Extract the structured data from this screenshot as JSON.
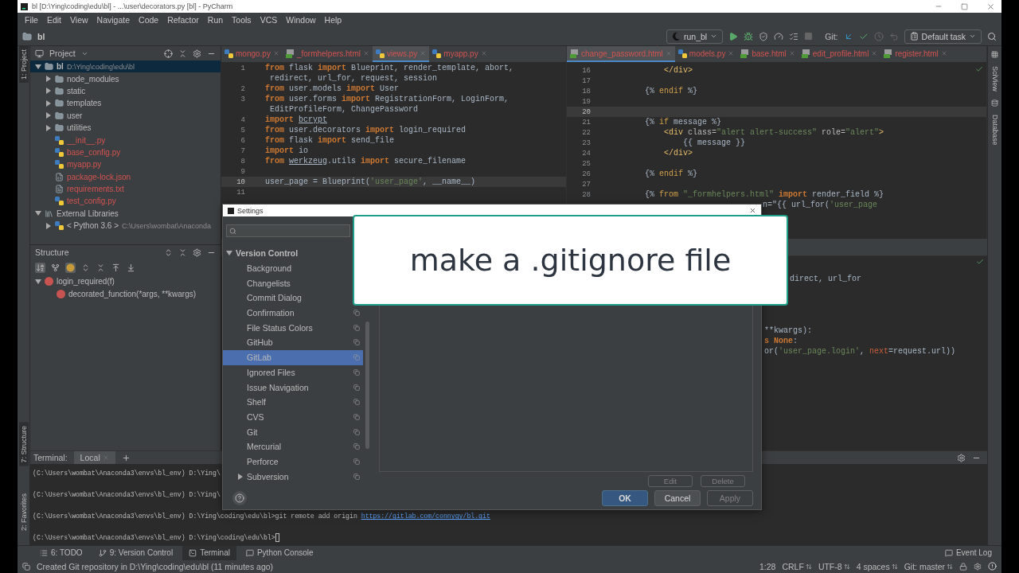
{
  "window": {
    "title": "bl [D:\\Ying\\coding\\edu\\bl] - ...\\user\\decorators.py [bl] - PyCharm"
  },
  "menu": [
    "File",
    "Edit",
    "View",
    "Navigate",
    "Code",
    "Refactor",
    "Run",
    "Tools",
    "VCS",
    "Window",
    "Help"
  ],
  "navbar": {
    "breadcrumb": "bl",
    "run_config": "run_bl",
    "git_label": "Git:",
    "task": "Default task"
  },
  "left_stripe": {
    "top": [
      {
        "label": "1: Project",
        "selected": true
      }
    ],
    "bottom": [
      {
        "label": "7: Structure",
        "selected": true
      },
      {
        "label": "2: Favorites",
        "selected": false
      }
    ]
  },
  "right_stripe": [
    {
      "label": "SciView",
      "kind": "grid"
    },
    {
      "label": "Database",
      "kind": "database"
    }
  ],
  "project": {
    "title": "Project",
    "tree": [
      {
        "label": "bl",
        "path": "D:\\Ying\\coding\\edu\\bl",
        "kind": "root",
        "expanded": true,
        "selected": true,
        "unversioned": false,
        "children": [
          {
            "label": "node_modules",
            "kind": "folder",
            "expanded": false,
            "selected": false,
            "unversioned": false
          },
          {
            "label": "static",
            "kind": "folder",
            "expanded": false,
            "selected": false,
            "unversioned": false
          },
          {
            "label": "templates",
            "kind": "folder",
            "expanded": false,
            "selected": false,
            "unversioned": false
          },
          {
            "label": "user",
            "kind": "folder",
            "expanded": false,
            "selected": false,
            "unversioned": false
          },
          {
            "label": "utilities",
            "kind": "folder",
            "expanded": false,
            "selected": false,
            "unversioned": false
          },
          {
            "label": "__init__.py",
            "kind": "python",
            "selected": false,
            "unversioned": true
          },
          {
            "label": "base_config.py",
            "kind": "python",
            "selected": false,
            "unversioned": true
          },
          {
            "label": "myapp.py",
            "kind": "python",
            "selected": false,
            "unversioned": true
          },
          {
            "label": "package-lock.json",
            "kind": "json",
            "selected": false,
            "unversioned": true
          },
          {
            "label": "requirements.txt",
            "kind": "text",
            "selected": false,
            "unversioned": true
          },
          {
            "label": "test_config.py",
            "kind": "python",
            "selected": false,
            "unversioned": true
          }
        ]
      },
      {
        "label": "External Libraries",
        "kind": "library",
        "expanded": true,
        "selected": false,
        "unversioned": false,
        "children": [
          {
            "label": "< Python 3.6 >",
            "path": "C:\\Users\\wombat\\Anaconda",
            "kind": "sdk",
            "expanded": false,
            "selected": false,
            "unversioned": false
          }
        ]
      }
    ]
  },
  "structure": {
    "title": "Structure",
    "tree": [
      {
        "label": "login_required(f)",
        "expanded": true,
        "children": [
          {
            "label": "decorated_function(*args, **kwargs)"
          }
        ]
      }
    ]
  },
  "editor_left": {
    "tabs": [
      {
        "label": "mongo.py",
        "kind": "python",
        "selected": false
      },
      {
        "label": "_formhelpers.html",
        "kind": "html",
        "selected": false
      },
      {
        "label": "views.py",
        "kind": "python",
        "selected": true
      },
      {
        "label": "myapp.py",
        "kind": "python",
        "selected": false
      }
    ],
    "lines": [
      {
        "number": "1",
        "current": false,
        "tokens": [
          {
            "kind": "kw",
            "text": "from"
          },
          {
            "kind": "id",
            "text": " flask "
          },
          {
            "kind": "kw",
            "text": "import"
          },
          {
            "kind": "id",
            "text": " Blueprint, render_template, abort,"
          }
        ]
      },
      {
        "current": false,
        "tokens": [
          {
            "kind": "id",
            "text": " redirect, url_for, request, session"
          }
        ]
      },
      {
        "number": "2",
        "current": false,
        "tokens": [
          {
            "kind": "kw",
            "text": "from"
          },
          {
            "kind": "id",
            "text": " user.models "
          },
          {
            "kind": "kw",
            "text": "import"
          },
          {
            "kind": "id",
            "text": " User"
          }
        ]
      },
      {
        "number": "3",
        "current": false,
        "tokens": [
          {
            "kind": "kw",
            "text": "from"
          },
          {
            "kind": "id",
            "text": " user.forms "
          },
          {
            "kind": "kw",
            "text": "import"
          },
          {
            "kind": "id",
            "text": " RegistrationForm, LoginForm,"
          }
        ]
      },
      {
        "current": false,
        "tokens": [
          {
            "kind": "id",
            "text": " EditProfileForm, ChangePassword"
          }
        ]
      },
      {
        "number": "4",
        "current": false,
        "tokens": [
          {
            "kind": "kw",
            "text": "import "
          },
          {
            "kind": "warn",
            "text": "bcrypt"
          }
        ]
      },
      {
        "number": "5",
        "current": false,
        "tokens": [
          {
            "kind": "kw",
            "text": "from"
          },
          {
            "kind": "id",
            "text": " user.decorators "
          },
          {
            "kind": "kw",
            "text": "import"
          },
          {
            "kind": "id",
            "text": " login_required"
          }
        ]
      },
      {
        "number": "6",
        "current": false,
        "tokens": [
          {
            "kind": "kw",
            "text": "from"
          },
          {
            "kind": "id",
            "text": " flask "
          },
          {
            "kind": "kw",
            "text": "import"
          },
          {
            "kind": "id",
            "text": " send_file"
          }
        ]
      },
      {
        "number": "7",
        "current": false,
        "tokens": [
          {
            "kind": "kw",
            "text": "import"
          },
          {
            "kind": "id",
            "text": " io"
          }
        ]
      },
      {
        "number": "8",
        "current": false,
        "tokens": [
          {
            "kind": "kw",
            "text": "from "
          },
          {
            "kind": "warn",
            "text": "werkzeug"
          },
          {
            "kind": "id",
            "text": ".utils "
          },
          {
            "kind": "kw",
            "text": "import"
          },
          {
            "kind": "id",
            "text": " secure_filename"
          }
        ]
      },
      {
        "number": "9",
        "current": false
      },
      {
        "number": "10",
        "current": true,
        "tokens": [
          {
            "kind": "id",
            "text": "user_page = Blueprint("
          },
          {
            "kind": "str",
            "text": "'user_page'"
          },
          {
            "kind": "id",
            "text": ", __name__)"
          }
        ]
      },
      {
        "number": "11",
        "current": false
      }
    ]
  },
  "editor_right": {
    "tabs": [
      {
        "label": "change_password.html",
        "kind": "html",
        "selected": true
      },
      {
        "label": "models.py",
        "kind": "python",
        "selected": false
      },
      {
        "label": "base.html",
        "kind": "html",
        "selected": false
      },
      {
        "label": "edit_profile.html",
        "kind": "html",
        "selected": false
      },
      {
        "label": "register.html",
        "kind": "html",
        "selected": false
      }
    ],
    "lines": [
      {
        "number": "16",
        "current": false,
        "tokens": [
          {
            "kind": "tag",
            "text": "    </div>"
          }
        ]
      },
      {
        "number": "17",
        "current": false
      },
      {
        "number": "18",
        "current": false,
        "tokens": [
          {
            "kind": "jd",
            "text": "{% "
          },
          {
            "kind": "jk",
            "text": "endif"
          },
          {
            "kind": "jd",
            "text": " %}"
          }
        ]
      },
      {
        "number": "19",
        "current": false
      },
      {
        "number": "20",
        "current": true
      },
      {
        "number": "21",
        "current": false,
        "tokens": [
          {
            "kind": "jd",
            "text": "{% "
          },
          {
            "kind": "jk",
            "text": "if"
          },
          {
            "kind": "id",
            "text": " message "
          },
          {
            "kind": "jd",
            "text": "%}"
          }
        ]
      },
      {
        "number": "22",
        "current": false,
        "tokens": [
          {
            "kind": "tag",
            "text": "    <div "
          },
          {
            "kind": "attr",
            "text": "class="
          },
          {
            "kind": "str",
            "text": "\"alert alert-success\""
          },
          {
            "kind": "attr",
            "text": " role="
          },
          {
            "kind": "str",
            "text": "\"alert\""
          },
          {
            "kind": "tag",
            "text": ">"
          }
        ]
      },
      {
        "number": "23",
        "current": false,
        "tokens": [
          {
            "kind": "id",
            "text": "        {{ message }}"
          }
        ]
      },
      {
        "number": "24",
        "current": false,
        "tokens": [
          {
            "kind": "tag",
            "text": "    </div>"
          }
        ]
      },
      {
        "number": "25",
        "current": false
      },
      {
        "number": "26",
        "current": false,
        "tokens": [
          {
            "kind": "jd",
            "text": "{% "
          },
          {
            "kind": "jk",
            "text": "endif"
          },
          {
            "kind": "jd",
            "text": " %}"
          }
        ]
      },
      {
        "number": "27",
        "current": false
      },
      {
        "number": "28",
        "current": false,
        "tokens": [
          {
            "kind": "jd",
            "text": "{% "
          },
          {
            "kind": "jk",
            "text": "from"
          },
          {
            "kind": "str",
            "text": " \"_formhelpers.html\""
          },
          {
            "kind": "kw",
            "text": " import"
          },
          {
            "kind": "id",
            "text": " render_field %}"
          }
        ]
      }
    ],
    "partial_line": {
      "tokens": [
        {
          "kind": "id",
          "text": "n=\"{{ url_for("
        },
        {
          "kind": "str",
          "text": "'user_page"
        }
      ]
    }
  },
  "editor_lower": {
    "groups": [
      {
        "kind": "beside_caption",
        "lines": [
          {
            "tokens": [
              {
                "kind": "id",
                "text": "direct, url_for"
              }
            ]
          }
        ]
      },
      {
        "kind": "beside_dialog",
        "lines": [
          {
            "tokens": [
              {
                "kind": "id",
                "text": "**kwargs):"
              }
            ]
          },
          {
            "tokens": [
              {
                "kind": "kw",
                "text": "s None"
              },
              {
                "kind": "id",
                "text": ":"
              }
            ]
          },
          {
            "tokens": [
              {
                "kind": "id",
                "text": "or("
              },
              {
                "kind": "str",
                "text": "'user_page.login'"
              },
              {
                "kind": "id",
                "text": ", "
              },
              {
                "kind": "param",
                "text": "next"
              },
              {
                "kind": "id",
                "text": "=request.url))"
              }
            ]
          }
        ]
      }
    ]
  },
  "terminal": {
    "title": "Terminal:",
    "tabs": [
      {
        "label": "Local",
        "selected": true
      }
    ],
    "lines": [
      {
        "text": "(C:\\Users\\wombat\\Anaconda3\\envs\\bl_env) D:\\Ying\\",
        "cursor": false
      },
      {
        "text": "(C:\\Users\\wombat\\Anaconda3\\envs\\bl_env) D:\\Ying\\",
        "cursor": false
      },
      {
        "text": "(C:\\Users\\wombat\\Anaconda3\\envs\\bl_env) D:\\Ying\\coding\\edu\\bl>git remote add origin ",
        "link": "https://gitlab.com/connygy/bl.git",
        "cursor": false
      },
      {
        "text": "(C:\\Users\\wombat\\Anaconda3\\envs\\bl_env) D:\\Ying\\coding\\edu\\bl>",
        "cursor": true
      }
    ]
  },
  "tool_windows": [
    {
      "label": "6: TODO",
      "kind": "todo",
      "selected": false
    },
    {
      "label": "9: Version Control",
      "kind": "vcs",
      "selected": false
    },
    {
      "label": "Terminal",
      "kind": "terminal",
      "selected": true
    },
    {
      "label": "Python Console",
      "kind": "python",
      "selected": false
    }
  ],
  "event_log": "Event Log",
  "status_bar": {
    "message": "Created Git repository in D:\\Ying\\coding\\edu\\bl (11 minutes ago)",
    "items": [
      {
        "label": "1:28",
        "dropdown": false
      },
      {
        "label": "CRLF",
        "dropdown": true
      },
      {
        "label": "UTF-8",
        "dropdown": true
      },
      {
        "label": "4 spaces",
        "dropdown": true
      },
      {
        "label": "Git: master",
        "dropdown": true
      }
    ]
  },
  "dialog": {
    "title": "Settings",
    "tree": [
      {
        "label": "Version Control",
        "expanded": true,
        "children": [
          {
            "label": "Background",
            "selected": false,
            "project_icon": false
          },
          {
            "label": "Changelists",
            "selected": false,
            "project_icon": false
          },
          {
            "label": "Commit Dialog",
            "selected": false,
            "project_icon": false
          },
          {
            "label": "Confirmation",
            "selected": false,
            "project_icon": true
          },
          {
            "label": "File Status Colors",
            "selected": false,
            "project_icon": true
          },
          {
            "label": "GitHub",
            "selected": false,
            "project_icon": true
          },
          {
            "label": "GitLab",
            "selected": true,
            "project_icon": true
          },
          {
            "label": "Ignored Files",
            "selected": false,
            "project_icon": true
          },
          {
            "label": "Issue Navigation",
            "selected": false,
            "project_icon": true
          },
          {
            "label": "Shelf",
            "selected": false,
            "project_icon": true
          },
          {
            "label": "CVS",
            "selected": false,
            "project_icon": true
          },
          {
            "label": "Git",
            "selected": false,
            "project_icon": true
          },
          {
            "label": "Mercurial",
            "selected": false,
            "project_icon": true
          },
          {
            "label": "Perforce",
            "selected": false,
            "project_icon": true
          },
          {
            "label": "Subversion",
            "selected": false,
            "project_icon": true,
            "expanded": false
          }
        ]
      }
    ],
    "side_buttons": [
      {
        "label": "Edit",
        "disabled": true
      },
      {
        "label": "Delete",
        "disabled": true
      }
    ],
    "buttons": [
      {
        "label": "OK",
        "kind": "primary",
        "disabled": false
      },
      {
        "label": "Cancel",
        "kind": "normal",
        "disabled": false
      },
      {
        "label": "Apply",
        "kind": "normal",
        "disabled": true
      }
    ]
  },
  "caption": "make a .gitignore file"
}
